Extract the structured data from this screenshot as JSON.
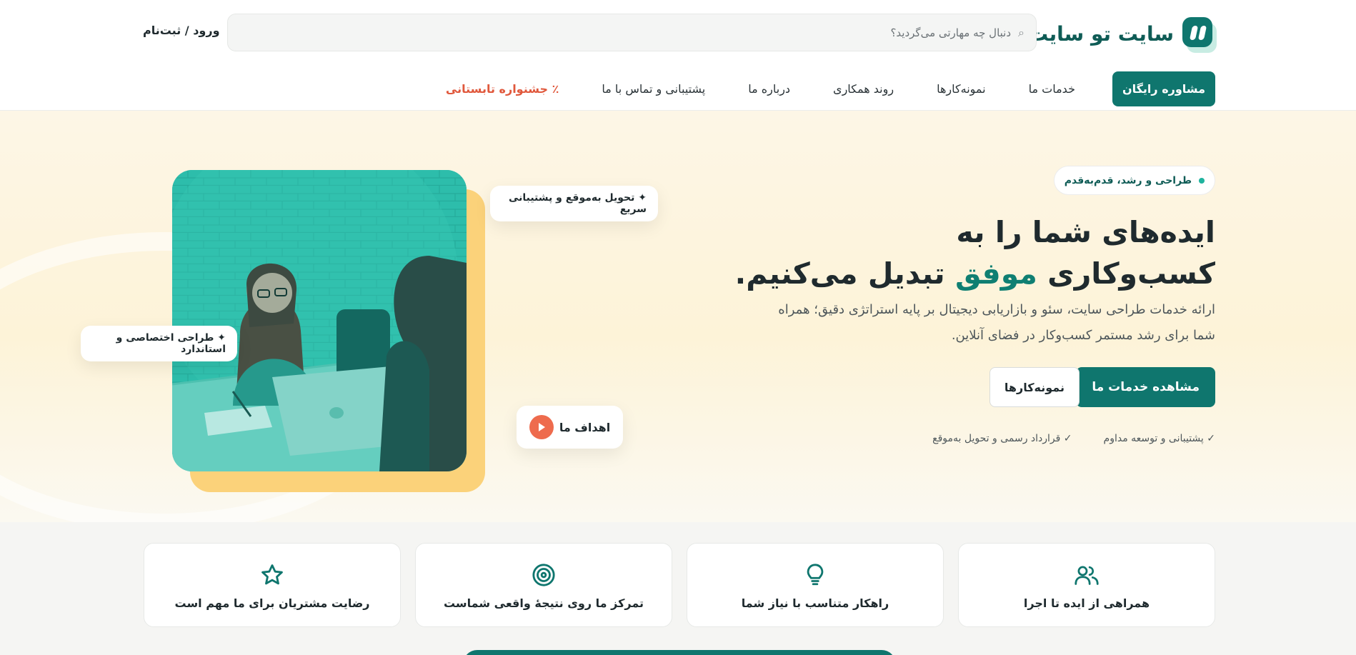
{
  "brand": {
    "name": "سایت تو سایت"
  },
  "search": {
    "placeholder": "دنبال چه مهارتی می‌گردید؟"
  },
  "auth": {
    "label": "ورود / ثبت‌نام"
  },
  "nav": {
    "cta": "مشاوره رایگان",
    "items": [
      "خدمات ما",
      "نمونه‌کارها",
      "روند همکاری",
      "درباره ما",
      "پشتیبانی و تماس با ما"
    ],
    "promo": "٪ جشنواره تابستانی"
  },
  "hero": {
    "chip": "طراحی و رشد، قدم‌به‌قدم",
    "headline_line1": "ایده‌های شما را به",
    "headline_part_a": "کسب‌وکاری",
    "headline_accent": "موفق",
    "headline_part_b": "تبدیل می‌کنیم.",
    "lead": "ارائه خدمات طراحی سایت، سئو و بازاریابی دیجیتال بر پایه استراتژی دقیق؛ همراه شما برای رشد مستمر کسب‌وکار در فضای آنلاین.",
    "primary_btn": "مشاهده خدمات ما",
    "secondary_btn": "نمونه‌کارها",
    "perks": [
      "✓ پشتیبانی و توسعه مداوم",
      "✓ قرارداد رسمی و تحویل به‌موقع"
    ],
    "float_1": "✦ تحویل به‌موقع و پشتیبانی سریع",
    "float_2": "✦ طراحی اختصاصی و استاندارد",
    "float_3": "اهداف ما"
  },
  "features": [
    {
      "label": "رضایت مشتریان برای ما مهم است",
      "icon": "star-icon"
    },
    {
      "label": "تمرکز ما روی نتیجهٔ واقعی شماست",
      "icon": "target-icon"
    },
    {
      "label": "راهکار متناسب با نیاز شما",
      "icon": "lightbulb-icon"
    },
    {
      "label": "همراهی از ایده تا اجرا",
      "icon": "users-icon"
    }
  ],
  "colors": {
    "brand": "#0f766e",
    "accent": "#0f7f72",
    "promo": "#e0583c",
    "play": "#ee6b4d",
    "image_back": "#fbd27a"
  }
}
